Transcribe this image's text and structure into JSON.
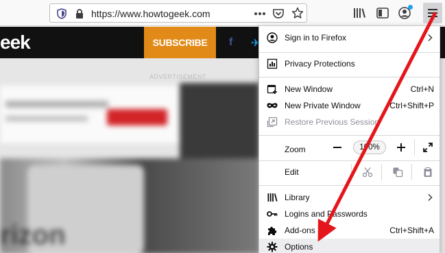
{
  "toolbar": {
    "url": "https://www.howtogeek.com",
    "url_prefix": "https://www.",
    "url_domain": "howtogeek.com"
  },
  "page": {
    "logo_fragment": "eek",
    "subscribe_label": "SUBSCRIBE",
    "ad_label": "ADVERTISEMENT",
    "facebook_glyph": "f",
    "twitter_glyph": "✈",
    "brand_fragment": "rizon"
  },
  "menu": {
    "sign_in": "Sign in to Firefox",
    "privacy": "Privacy Protections",
    "new_window": {
      "label": "New Window",
      "shortcut": "Ctrl+N"
    },
    "new_private_window": {
      "label": "New Private Window",
      "shortcut": "Ctrl+Shift+P"
    },
    "restore_session": "Restore Previous Session",
    "zoom": {
      "label": "Zoom",
      "value": "100%"
    },
    "edit": "Edit",
    "library": "Library",
    "logins": "Logins and Passwords",
    "addons": {
      "label": "Add-ons",
      "shortcut": "Ctrl+Shift+A"
    },
    "options": "Options"
  },
  "colors": {
    "annotation_arrow": "#e4161b",
    "subscribe": "#e28a17",
    "account_badge": "#1da1f2"
  }
}
